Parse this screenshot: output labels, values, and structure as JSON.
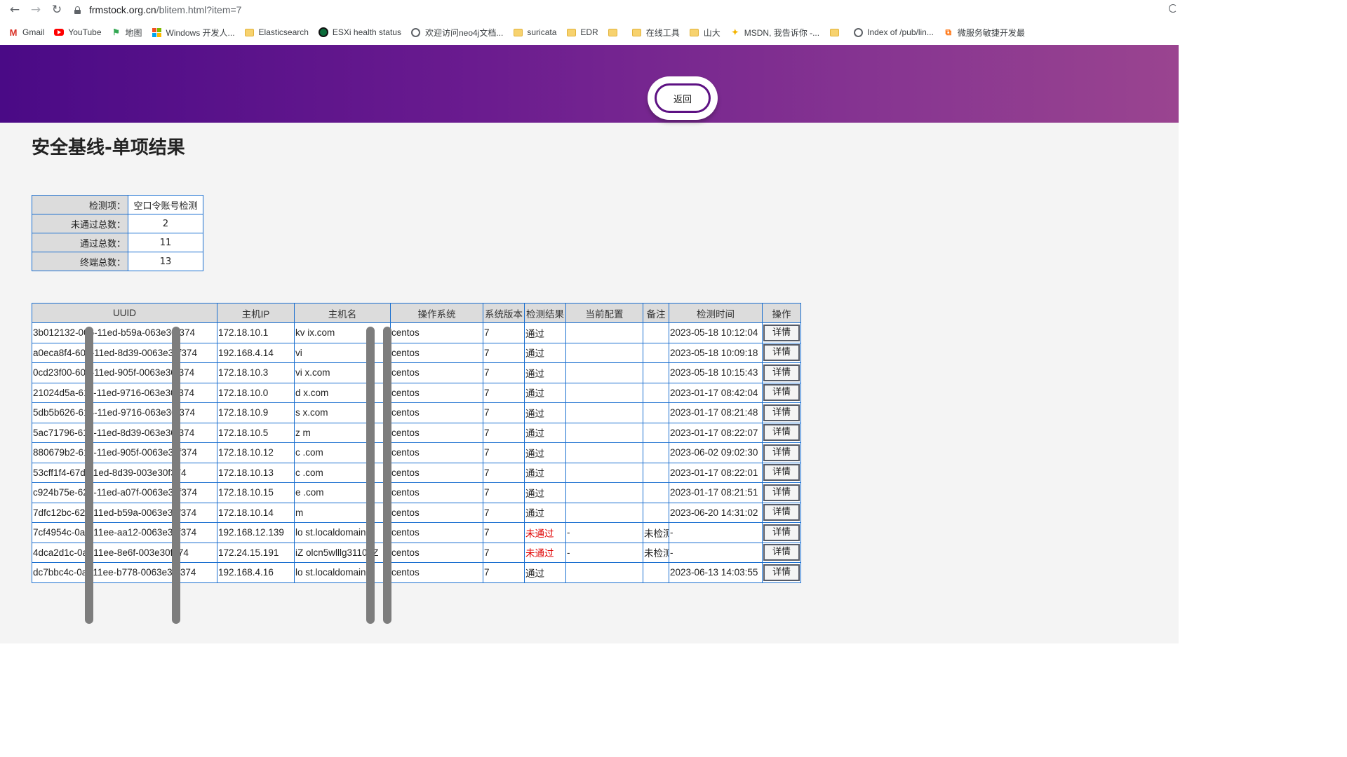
{
  "browser": {
    "url_host": "frmstock.org.cn",
    "url_path": "/blitem.html?item=7",
    "bookmarks": [
      {
        "label": "Gmail",
        "icon": "gmail-icon"
      },
      {
        "label": "YouTube",
        "icon": "youtube-icon"
      },
      {
        "label": "地图",
        "icon": "maps-icon"
      },
      {
        "label": "Windows 开发人...",
        "icon": "windows-icon"
      },
      {
        "label": "Elasticsearch",
        "icon": "folder-icon"
      },
      {
        "label": "ESXi health status",
        "icon": "esxi-icon"
      },
      {
        "label": "欢迎访问neo4j文档...",
        "icon": "globe-icon"
      },
      {
        "label": "suricata",
        "icon": "folder-icon"
      },
      {
        "label": "EDR",
        "icon": "folder-icon"
      },
      {
        "label": "",
        "icon": "folder-icon"
      },
      {
        "label": "在线工具",
        "icon": "folder-icon"
      },
      {
        "label": "山大",
        "icon": "folder-icon"
      },
      {
        "label": "MSDN, 我告诉你 -...",
        "icon": "msdn-icon"
      },
      {
        "label": "",
        "icon": "folder-icon"
      },
      {
        "label": "Index of /pub/lin...",
        "icon": "globe-icon"
      },
      {
        "label": "微服务敏捷开发最",
        "icon": "link-icon"
      }
    ]
  },
  "header": {
    "back_label": "返回"
  },
  "page": {
    "title": "安全基线-单项结果"
  },
  "summary": [
    {
      "key": "检测项：",
      "value": "空口令账号检测"
    },
    {
      "key": "未通过总数：",
      "value": "2"
    },
    {
      "key": "通过总数：",
      "value": "11"
    },
    {
      "key": "终端总数：",
      "value": "13"
    }
  ],
  "table": {
    "columns": [
      "UUID",
      "主机IP",
      "主机名",
      "操作系统",
      "系统版本",
      "检测结果",
      "当前配置",
      "备注",
      "检测时间",
      "操作"
    ],
    "action_label": "详情",
    "rows": [
      [
        "3b012132-0⁠06-11ed-b59a-0⁠63e30f374",
        "172.18.10.1",
        "kv  ix.com",
        "centos",
        "7",
        "通过",
        "",
        "",
        "2023-05-18 10:12:04"
      ],
      [
        "a0eca8f4-6⁠0b-11ed-8d39-00⁠63e30f374",
        "192.168.4.14",
        "vi",
        "centos",
        "7",
        "通过",
        "",
        "",
        "2023-05-18 10:09:18"
      ],
      [
        "0cd23f00-6⁠0e-11ed-905f-00⁠63e30f374",
        "172.18.10.3",
        "vi  x.com",
        "centos",
        "7",
        "通过",
        "",
        "",
        "2023-05-18 10:15:43"
      ],
      [
        "21024d5a-6⁠11-11ed-9716-0⁠63e30f374",
        "172.18.10.0",
        "d   x.com",
        "centos",
        "7",
        "通过",
        "",
        "",
        "2023-01-17 08:42:04"
      ],
      [
        "5db5b626-6⁠14-11ed-9716-0⁠63e30f374",
        "172.18.10.9",
        "s   x.com",
        "centos",
        "7",
        "通过",
        "",
        "",
        "2023-01-17 08:21:48"
      ],
      [
        "5ac71796-6⁠16-11ed-8d39-0⁠63e30f374",
        "172.18.10.5",
        "z   m",
        "centos",
        "7",
        "通过",
        "",
        "",
        "2023-01-17 08:22:07"
      ],
      [
        "880679b2-6⁠1c-11ed-905f-00⁠63e30f374",
        "172.18.10.12",
        "c   .com",
        "centos",
        "7",
        "通过",
        "",
        "",
        "2023-06-02 09:02:30"
      ],
      [
        "53cff1f4-67⁠d-11ed-8d39-00⁠3e30f374",
        "172.18.10.13",
        "c    .com",
        "centos",
        "7",
        "通过",
        "",
        "",
        "2023-01-17 08:22:01"
      ],
      [
        "c924b75e-6⁠23-11ed-a07f-00⁠63e30f374",
        "172.18.10.15",
        "e   .com",
        "centos",
        "7",
        "通过",
        "",
        "",
        "2023-01-17 08:21:51"
      ],
      [
        "7dfc12bc-6⁠24-11ed-b59a-00⁠63e30f374",
        "172.18.10.14",
        "m",
        "centos",
        "7",
        "通过",
        "",
        "",
        "2023-06-20 14:31:02"
      ],
      [
        "7cf4954c-0⁠a9-11ee-aa12-00⁠63e30f374",
        "192.168.12.139",
        "lo   st.localdomain",
        "centos",
        "7",
        "未通过",
        "-",
        "未检测",
        "-"
      ],
      [
        "4dca2d1c-0⁠af-11ee-8e6f-00⁠3e30f374",
        "172.24.15.191",
        "iZ   olcn5wlllg3110oZ",
        "centos",
        "7",
        "未通过",
        "-",
        "未检测",
        "-"
      ],
      [
        "dc7bbc4c-0⁠af-11ee-b778-00⁠63e30f374",
        "192.168.4.16",
        "lo   st.localdomain",
        "centos",
        "7",
        "通过",
        "",
        "",
        "2023-06-13 14:03:55"
      ]
    ]
  },
  "colors": {
    "banner_start": "#4a0a86",
    "banner_end": "#9a4490",
    "fail": "#e00000",
    "table_border": "#1a6fd0"
  }
}
